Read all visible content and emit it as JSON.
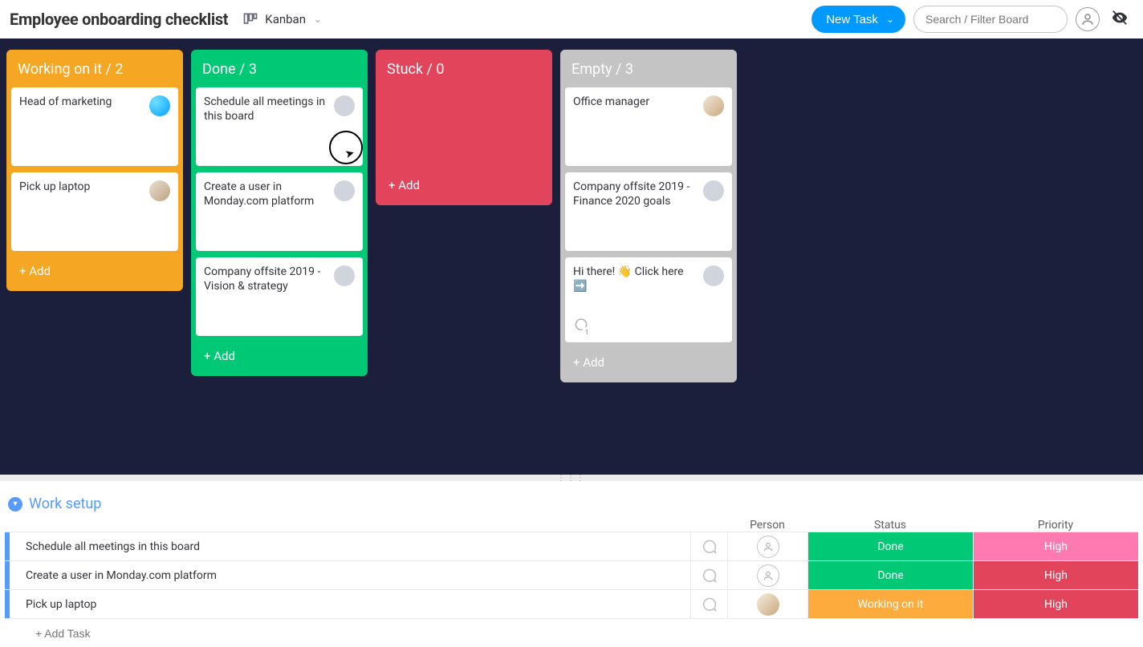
{
  "header": {
    "board_title": "Employee onboarding checklist",
    "view_label": "Kanban",
    "new_task_label": "New Task",
    "search_placeholder": "Search / Filter Board"
  },
  "columns": {
    "working": {
      "title": "Working on it / 2",
      "cards": [
        {
          "title": "Head of marketing"
        },
        {
          "title": "Pick up laptop"
        }
      ],
      "add_label": "+ Add"
    },
    "done": {
      "title": "Done / 3",
      "cards": [
        {
          "title": "Schedule all meetings in this board"
        },
        {
          "title": "Create a user in Monday.com platform"
        },
        {
          "title": "Company offsite 2019 - Vision & strategy"
        }
      ],
      "add_label": "+ Add"
    },
    "stuck": {
      "title": "Stuck / 0",
      "add_label": "+ Add"
    },
    "empty": {
      "title": "Empty / 3",
      "cards": [
        {
          "title": "Office manager"
        },
        {
          "title": "Company offsite 2019 - Finance 2020 goals"
        },
        {
          "title": "Hi there! 👋 Click here ➡️"
        }
      ],
      "add_label": "+ Add"
    }
  },
  "group": {
    "title": "Work setup",
    "columns": {
      "person": "Person",
      "status": "Status",
      "priority": "Priority"
    },
    "rows": [
      {
        "name": "Schedule all meetings in this board",
        "status": "Done",
        "priority": "High"
      },
      {
        "name": "Create a user in Monday.com platform",
        "status": "Done",
        "priority": "High"
      },
      {
        "name": "Pick up laptop",
        "status": "Working on it",
        "priority": "High"
      }
    ],
    "add_task_placeholder": "+ Add Task"
  }
}
